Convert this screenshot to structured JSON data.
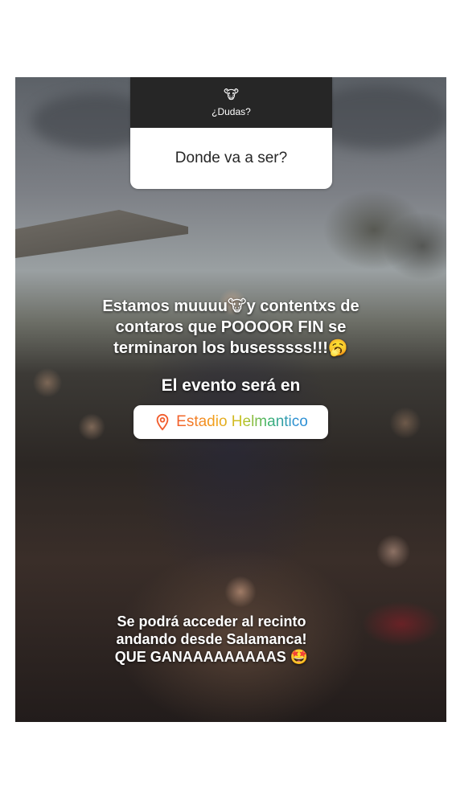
{
  "question_sticker": {
    "emoji": "🐮",
    "title": "¿Dudas?",
    "answer": "Donde va a ser?"
  },
  "messages": {
    "line1": "Estamos muuuu🐮y contentxs de",
    "line2": "contaros que POOOOR FIN se",
    "line3": "terminaron los busesssss!!!🥱",
    "event_intro": "El evento será en",
    "closing1": "Se podrá acceder al recinto",
    "closing2": "andando desde Salamanca!",
    "closing3": "QUE GANAAAAAAAAAS 🤩"
  },
  "location_sticker": {
    "icon": "location-pin-icon",
    "name": "Estadio Helmantico",
    "pin_color": "#f25c2c"
  }
}
